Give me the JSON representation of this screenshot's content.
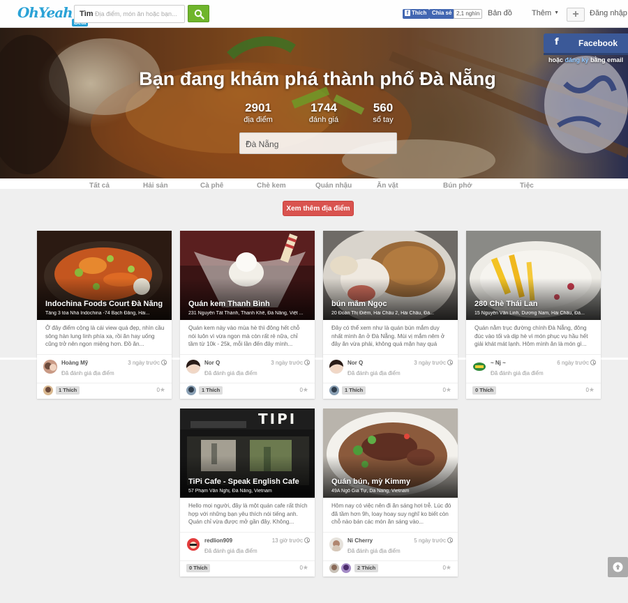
{
  "header": {
    "logo": "OhYeah",
    "beta": "Beta",
    "search_label": "Tìm",
    "search_placeholder": "Địa điểm, món ăn hoặc bạn...",
    "fb_like": "Thích",
    "fb_share": "Chia sẻ",
    "fb_count": "2,1 nghìn",
    "nav_map": "Bản đồ",
    "nav_more": "Thêm",
    "nav_login": "Đăng nhập"
  },
  "hero": {
    "title": "Bạn đang khám phá thành phố Đà Nẵng",
    "stats": [
      {
        "value": "2901",
        "label": "địa điểm"
      },
      {
        "value": "1744",
        "label": "đánh giá"
      },
      {
        "value": "560",
        "label": "sổ tay"
      }
    ],
    "city": "Đà Nẵng",
    "facebook_button": "Facebook",
    "or_text": "hoặc",
    "register_link": "đăng ký",
    "register_suffix": "bằng email"
  },
  "categories": [
    "Tất cả",
    "Hải sản",
    "Cà phê",
    "Chè kem",
    "Quán nhậu",
    "Ăn vặt",
    "Bún phở",
    "Tiệc"
  ],
  "more_button": "Xem thêm địa điểm",
  "cards": [
    {
      "name": "Indochina Foods Court Đà Nẵng",
      "address": "Tầng 3 tòa Nhà Indochina -74 Bạch Đằng, Hải...",
      "desc": "Ở đây điểm cộng là cái view quá đẹp, nhìn cầu sông hàn lung linh phía xa, rồi ăn hay uống cũng trở nên ngon miệng hơn. Đồ ăn...",
      "reviewer": "Hoàng Mỹ",
      "time": "3 ngày trước",
      "rated": "Đã đánh giá địa điểm",
      "likes": "1 Thích",
      "rating": "0"
    },
    {
      "name": "Quán kem Thanh Bình",
      "address": "231 Nguyễn Tất Thành, Thanh Khê, Đà Nẵng, Việt ...",
      "desc": "Quán kem này vào mùa hè thì đông hết chỗ nói luôn vì vừa ngon mà còn rất rẻ nữa, chỉ tầm từ 10k - 25k, mỗi lần đến đây mình...",
      "reviewer": "Nor Q",
      "time": "3 ngày trước",
      "rated": "Đã đánh giá địa điểm",
      "likes": "1 Thích",
      "rating": "0"
    },
    {
      "name": "bún mắm Ngọc",
      "address": "20 Đoàn Thị Điểm, Hải Châu 2, Hải Châu, Đà...",
      "desc": "Đây có thể xem như là quán bún mắm duy nhất mình ăn ở Đà Nẵng. Mùi vị mắm nêm ở đây ăn vừa phải, không quá mặn hay quá nhạt,...",
      "reviewer": "Nor Q",
      "time": "3 ngày trước",
      "rated": "Đã đánh giá địa điểm",
      "likes": "1 Thích",
      "rating": "0"
    },
    {
      "name": "280 Chè Thái Lan",
      "address": "15 Nguyễn Văn Linh, Dương Nam, Hải Châu, Đà...",
      "desc": "Quán nằm trục đường chính Đà Nẵng, đông đúc vào tối và dịp hè vì món phục vụ hầu hết giải khát mát lạnh. Hôm mình ăn là món gì...",
      "reviewer": "~ Nj ~",
      "time": "6 ngày trước",
      "rated": "Đã đánh giá địa điểm",
      "likes": "0 Thích",
      "rating": "0"
    },
    {
      "name": "TiPi Cafe - Speak English Cafe",
      "address": "57 Phạm Văn Nghị, Đà Nẵng, Vietnam",
      "desc": "Hello mọi người, đây là một quán cafe rất thích hợp với những bạn yêu thích nói tiếng anh. Quán chỉ vừa được mở gần đây. Không...",
      "reviewer": "redlion909",
      "time": "13 giờ trước",
      "rated": "Đã đánh giá địa điểm",
      "likes": "0 Thích",
      "rating": "0",
      "sign": "TIPI"
    },
    {
      "name": "Quán bún, mỳ Kimmy",
      "address": "49A Ngô Gia Tự, Da Nang, Vietnam",
      "desc": "Hôm nay có việc nên đi ăn sáng hơi trễ. Lúc đó đã tầm hơn 9h, loay hoay suy nghĩ ko biết còn chỗ nào bán các món ăn sáng vào...",
      "reviewer": "Ni Cherry",
      "time": "5 ngày trước",
      "rated": "Đã đánh giá địa điểm",
      "likes": "2 Thích",
      "rating": "0"
    }
  ]
}
